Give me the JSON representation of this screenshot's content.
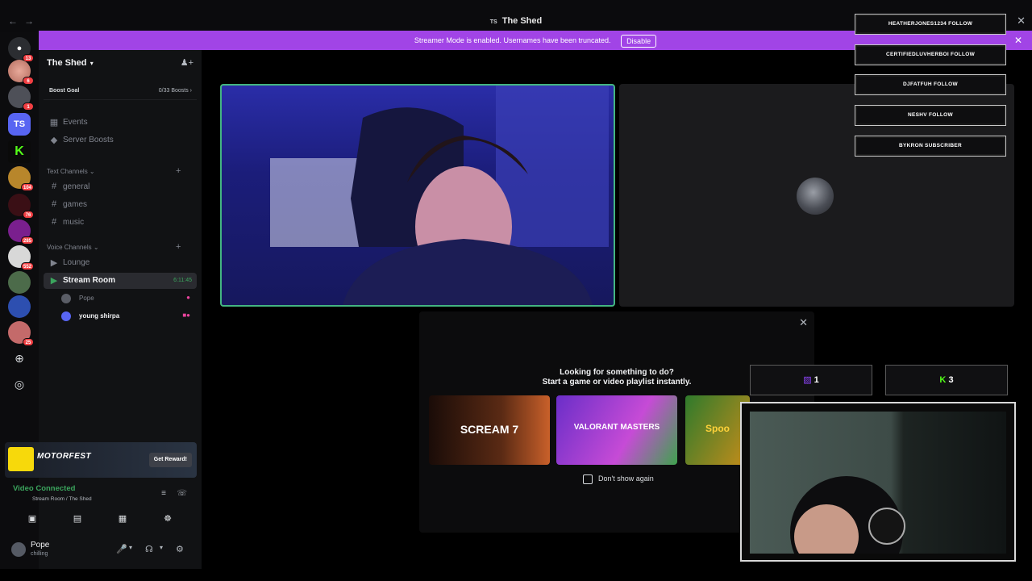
{
  "titlebar": {
    "back": "←",
    "forward": "→",
    "title": "The Shed",
    "ts": "TS",
    "close": "✕"
  },
  "banner": {
    "message": "Streamer Mode is enabled. Usernames have been truncated.",
    "disable_label": "Disable",
    "close": "✕"
  },
  "rail": {
    "badges": [
      "13",
      "6",
      "1",
      "104",
      "76",
      "285",
      "552",
      "25"
    ],
    "ts_label": "TS"
  },
  "sidebar": {
    "guild_name": "The Shed",
    "boost_goal": "Boost Goal",
    "boost_count": "0/33 Boosts",
    "events": "Events",
    "server_boosts": "Server Boosts",
    "text_category": "Text Channels",
    "text_channels": [
      "general",
      "games",
      "music"
    ],
    "voice_category": "Voice Channels",
    "voice_channels": [
      "Lounge",
      "Stream Room"
    ],
    "stream_timer": "6:11:45",
    "voice_users": [
      "Pope",
      "young shirpa"
    ]
  },
  "promo": {
    "game": "MOTORFEST",
    "brand": "THE CREW",
    "cta": "Get Reward!"
  },
  "voice_connection": {
    "status": "Video Connected",
    "location": "Stream Room / The Shed"
  },
  "user_panel": {
    "name": "Pope",
    "status": "chilling"
  },
  "activity_tip": {
    "line1": "Looking for something to do?",
    "line2": "Start a game or video playlist instantly.",
    "cards": [
      "SCREAM 7",
      "VALORANT MASTERS",
      "Spoo"
    ],
    "dont_show": "Don't show again"
  },
  "overlay": {
    "alerts": [
      "HEATHERJONES1234 FOLLOW",
      "CERTIFIEDLUVHERBOI FOLLOW",
      "DJFATFUH FOLLOW",
      "NESHV FOLLOW",
      "BYKRON SUBSCRIBER"
    ],
    "twitch_count": "1",
    "kick_count": "3"
  },
  "colors": {
    "banner": "#a144e6",
    "speaking": "#43b581",
    "voice_green": "#3ba55d",
    "badge": "#f23f43"
  }
}
